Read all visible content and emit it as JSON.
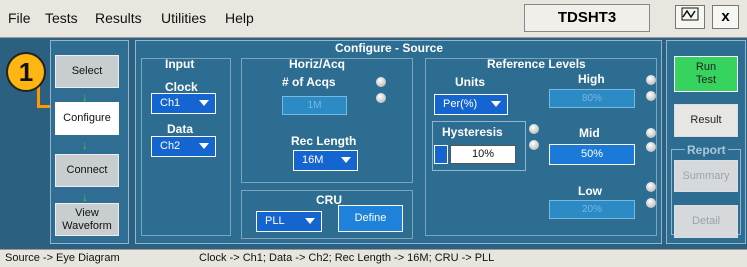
{
  "menu": {
    "file": "File",
    "tests": "Tests",
    "results": "Results",
    "utilities": "Utilities",
    "help": "Help"
  },
  "product": "TDSHT3",
  "window": {
    "close": "x"
  },
  "marker": "1",
  "nav": {
    "select": "Select",
    "configure": "Configure",
    "connect": "Connect",
    "view_waveform": "View\nWaveform"
  },
  "title": "Configure - Source",
  "input": {
    "heading": "Input",
    "clock_label": "Clock",
    "clock_value": "Ch1",
    "data_label": "Data",
    "data_value": "Ch2"
  },
  "horiz": {
    "heading": "Horiz/Acq",
    "acqs_label": "# of Acqs",
    "acqs_value": "1M",
    "rec_label": "Rec Length",
    "rec_value": "16M"
  },
  "cru": {
    "heading": "CRU",
    "value": "PLL",
    "define": "Define"
  },
  "ref": {
    "heading": "Reference Levels",
    "units_label": "Units",
    "units_value": "Per(%)",
    "high_label": "High",
    "high_value": "80%",
    "hyst_label": "Hysteresis",
    "hyst_value": "10%",
    "mid_label": "Mid",
    "mid_value": "50%",
    "low_label": "Low",
    "low_value": "20%"
  },
  "right": {
    "run_test": "Run\nTest",
    "result": "Result",
    "report_heading": "Report",
    "summary": "Summary",
    "detail": "Detail"
  },
  "status": {
    "left": "Source -> Eye Diagram",
    "right": "Clock -> Ch1; Data -> Ch2; Rec Length -> 16M; CRU -> PLL"
  }
}
